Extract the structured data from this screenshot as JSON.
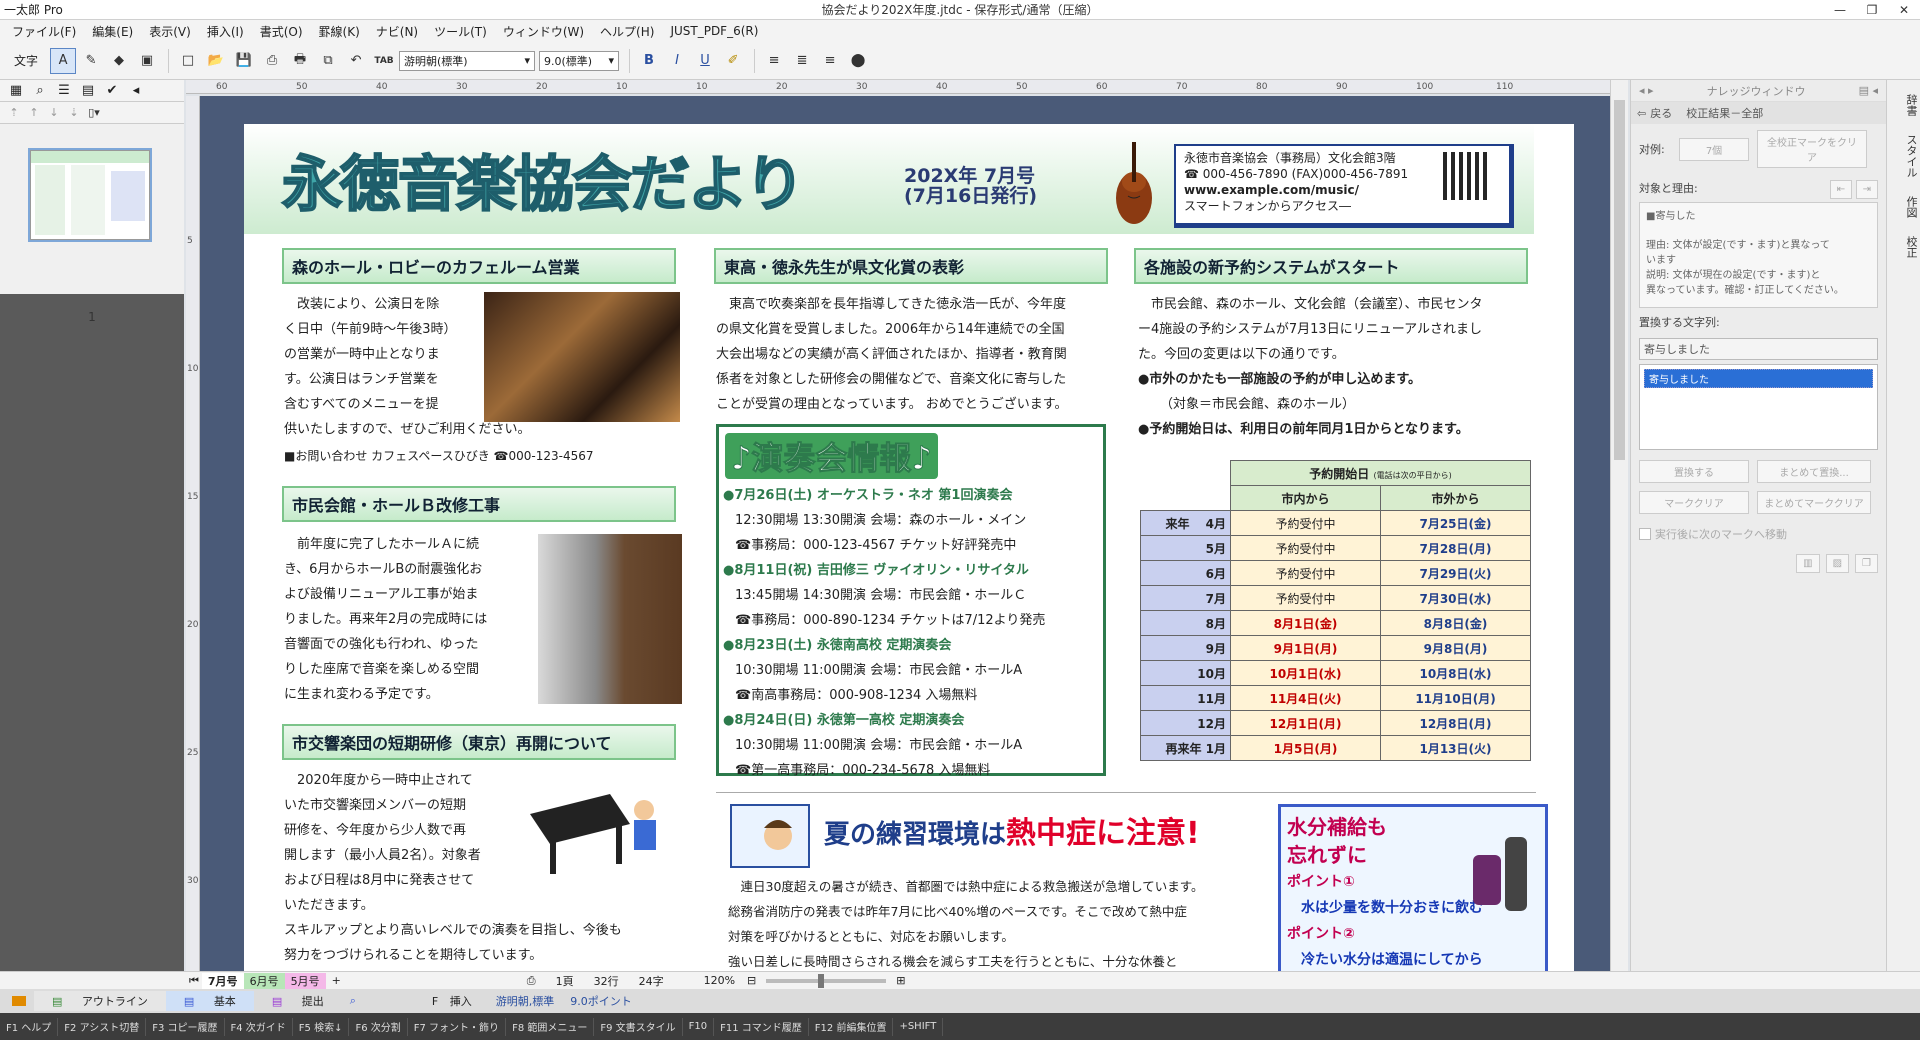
{
  "app": {
    "name": "一太郎 Pro",
    "doc_title": "協会だより202X年度.jtdc - 保存形式/通常（圧縮）"
  },
  "menu": [
    "ファイル(F)",
    "編集(E)",
    "表示(V)",
    "挿入(I)",
    "書式(O)",
    "罫線(K)",
    "ナビ(N)",
    "ツール(T)",
    "ウィンドウ(W)",
    "ヘルプ(H)",
    "JUST_PDF_6(R)"
  ],
  "toolbar": {
    "mode_label": "文字",
    "font": "游明朝(標準)",
    "size": "9.0(標準)",
    "tab_label": "TAB"
  },
  "thumbnail_page_number": "1",
  "ruler": {
    "h": [
      "60",
      "50",
      "40",
      "30",
      "20",
      "10",
      "10",
      "20",
      "30",
      "40",
      "50",
      "60",
      "70",
      "80",
      "90",
      "100",
      "110"
    ],
    "v": [
      "5",
      "10",
      "15",
      "20",
      "25",
      "30"
    ]
  },
  "newsletter": {
    "title": "永徳音楽協会だより",
    "issue1": "202X年 7月号",
    "issue2": "(7月16日発行)",
    "contact": {
      "line1": "永徳市音楽協会（事務局）文化会館3階",
      "line2": "☎ 000-456-7890 (FAX)000-456-7891",
      "line3": "www.example.com/music/",
      "line4": "スマートフォンからアクセス―"
    },
    "sec1": {
      "title": "森のホール・ロビーのカフェルーム営業",
      "body": [
        "改装により、公演日を除",
        "く日中（午前9時〜午後3時）",
        "の営業が一時中止となりま",
        "す。公演日はランチ営業を",
        "含むすべてのメニューを提",
        "供いたしますので、ぜひご利用ください。"
      ],
      "contact": "■お問い合わせ カフェスペースひびき ☎000-123-4567"
    },
    "sec2": {
      "title": "市民会館・ホールＢ改修工事",
      "body": [
        "前年度に完了したホールＡに続",
        "き、6月からホールBの耐震強化お",
        "よび設備リニューアル工事が始ま",
        "りました。再来年2月の完成時には",
        "音響面での強化も行われ、ゆった",
        "りした座席で音楽を楽しめる空間",
        "に生まれ変わる予定です。"
      ]
    },
    "sec3": {
      "title": "市交響楽団の短期研修（東京）再開について",
      "body": [
        "2020年度から一時中止されて",
        "いた市交響楽団メンバーの短期",
        "研修を、今年度から少人数で再",
        "開します（最小人員2名）。対象者",
        "および日程は8月中に発表させて",
        "いただきます。",
        "スキルアップとより高いレベルでの演奏を目指し、今後も",
        "努力をつづけられることを期待しています。"
      ]
    },
    "sec4": {
      "title": "東高・徳永先生が県文化賞の表彰",
      "body": [
        "東高で吹奏楽部を長年指導してきた徳永浩一氏が、今年度",
        "の県文化賞を受賞しました。2006年から14年連続での全国",
        "大会出場などの実績が高く評価されたほか、指導者・教育関",
        "係者を対象とした研修会の開催などで、音楽文化に寄与した",
        "ことが受賞の理由となっています。 おめでとうございます。"
      ]
    },
    "concert": {
      "title": "♪演奏会情報♪",
      "lines": [
        {
          "t": "●7月26日(土) オーケストラ・ネオ 第1回演奏会",
          "k": "h"
        },
        {
          "t": "12:30開場 13:30開演 会場：森のホール・メイン",
          "k": "s"
        },
        {
          "t": "☎事務局：000-123-4567 チケット好評発売中",
          "k": "s"
        },
        {
          "t": "●8月11日(祝) 吉田修三 ヴァイオリン・リサイタル",
          "k": "h"
        },
        {
          "t": "13:45開場 14:30開演 会場：市民会館・ホールＣ",
          "k": "s"
        },
        {
          "t": "☎事務局：000-890-1234 チケットは7/12より発売",
          "k": "s"
        },
        {
          "t": "●8月23日(土) 永徳南高校 定期演奏会",
          "k": "h"
        },
        {
          "t": "10:30開場 11:00開演 会場：市民会館・ホールA",
          "k": "s"
        },
        {
          "t": "☎南高事務局：000-908-1234 入場無料",
          "k": "s"
        },
        {
          "t": "●8月24日(日) 永徳第一高校 定期演奏会",
          "k": "h"
        },
        {
          "t": "10:30開場 11:00開演 会場：市民会館・ホールA",
          "k": "s"
        },
        {
          "t": "☎第一高事務局：000-234-5678 入場無料",
          "k": "s"
        }
      ]
    },
    "sec5": {
      "title": "各施設の新予約システムがスタート",
      "body": [
        "市民会館、森のホール、文化会館（会議室）、市民センタ",
        "ー4施設の予約システムが7月13日にリニューアルされまし",
        "た。今回の変更は以下の通りです。"
      ],
      "bullet1": "●市外のかたも一部施設の予約が申し込めます。",
      "bullet1b": "（対象＝市民会館、森のホール）",
      "bullet2": "●予約開始日は、利用日の前年同月1日からとなります。"
    },
    "table": {
      "header": "予約開始日",
      "header_note": "(電話は次の平日から)",
      "col1": "市内から",
      "col2": "市外から",
      "rows": [
        {
          "m": "来年　 4月",
          "a": "予約受付中",
          "b": "7月25日(金)",
          "ak": "rec"
        },
        {
          "m": "5月",
          "a": "予約受付中",
          "b": "7月28日(月)",
          "ak": "rec"
        },
        {
          "m": "6月",
          "a": "予約受付中",
          "b": "7月29日(火)",
          "ak": "rec"
        },
        {
          "m": "7月",
          "a": "予約受付中",
          "b": "7月30日(水)",
          "ak": "rec"
        },
        {
          "m": "8月",
          "a": "8月1日(金)",
          "b": "8月8日(金)",
          "ak": "red"
        },
        {
          "m": "9月",
          "a": "9月1日(月)",
          "b": "9月8日(月)",
          "ak": "red"
        },
        {
          "m": "10月",
          "a": "10月1日(水)",
          "b": "10月8日(水)",
          "ak": "red"
        },
        {
          "m": "11月",
          "a": "11月4日(火)",
          "b": "11月10日(月)",
          "ak": "red"
        },
        {
          "m": "12月",
          "a": "12月1日(月)",
          "b": "12月8日(月)",
          "ak": "red"
        },
        {
          "m": "再来年 1月",
          "a": "1月5日(月)",
          "b": "1月13日(火)",
          "ak": "red"
        }
      ]
    },
    "heat": {
      "part1": "夏の練習環境は",
      "part2": "熱中症に注意!",
      "body": [
        "連日30度超えの暑さが続き、首都圏では熱中症による救急搬送が急増しています。",
        "総務省消防庁の発表では昨年7月に比べ40%増のペースです。そこで改めて熱中症",
        "対策を呼びかけるとともに、対応をお願いします。",
        "強い日差しに長時間さらされる機会を減らす工夫を行うとともに、十分な休養と"
      ]
    },
    "water": {
      "h1": "水分補給も",
      "h2": "忘れずに",
      "p1": "ポイント①",
      "p1t": "水は少量を数十分おきに飲む",
      "p2": "ポイント②",
      "p2t": "冷たい水分は適温にしてから"
    }
  },
  "knowledge": {
    "title": "ナレッジウィンドウ",
    "back": "戻る",
    "result": "校正結果－全部",
    "label_sample": "对例:",
    "btn_7": "7個",
    "btn_all": "全校正マークをクリア",
    "reason_label": "対象と理由:",
    "reason_box": [
      "■寄与した",
      "",
      "理由: 文体が設定(です・ます)と異なって",
      "います",
      "説明: 文体が現在の設定(です・ます)と",
      "異なっています。確認・訂正してください。"
    ],
    "replace_label": "置換する文字列:",
    "replace_value": "寄与しました",
    "list_item": "寄与しました",
    "btn_replace": "置換する",
    "btn_replace_all": "まとめて置換...",
    "btn_clear": "マーククリア",
    "btn_clear_all": "まとめてマーククリア",
    "check_label": "実行後に次のマークへ移動"
  },
  "side_tabs": [
    "辞書",
    "スタイル",
    "作図",
    "校正"
  ],
  "status": {
    "tabs": [
      "7月号",
      "6月号",
      "5月号"
    ],
    "page": "1頁",
    "line": "32行",
    "col": "24字",
    "zoom": "120%"
  },
  "modebar": {
    "outline": "アウトライン",
    "basic": "基本",
    "submit": "提出",
    "insert": "挿入",
    "font": "游明朝,標準",
    "size": "9.0ポイント"
  },
  "fnkeys": [
    "F1 ヘルプ",
    "F2 アシスト切替",
    "F3 コピー履歴",
    "F4 次ガイド",
    "F5 検索↓",
    "F6 次分割",
    "F7 フォント・飾り",
    "F8 範囲メニュー",
    "F9 文書スタイル",
    "F10",
    "F11 コマンド履歴",
    "F12 前編集位置",
    "+SHIFT"
  ]
}
